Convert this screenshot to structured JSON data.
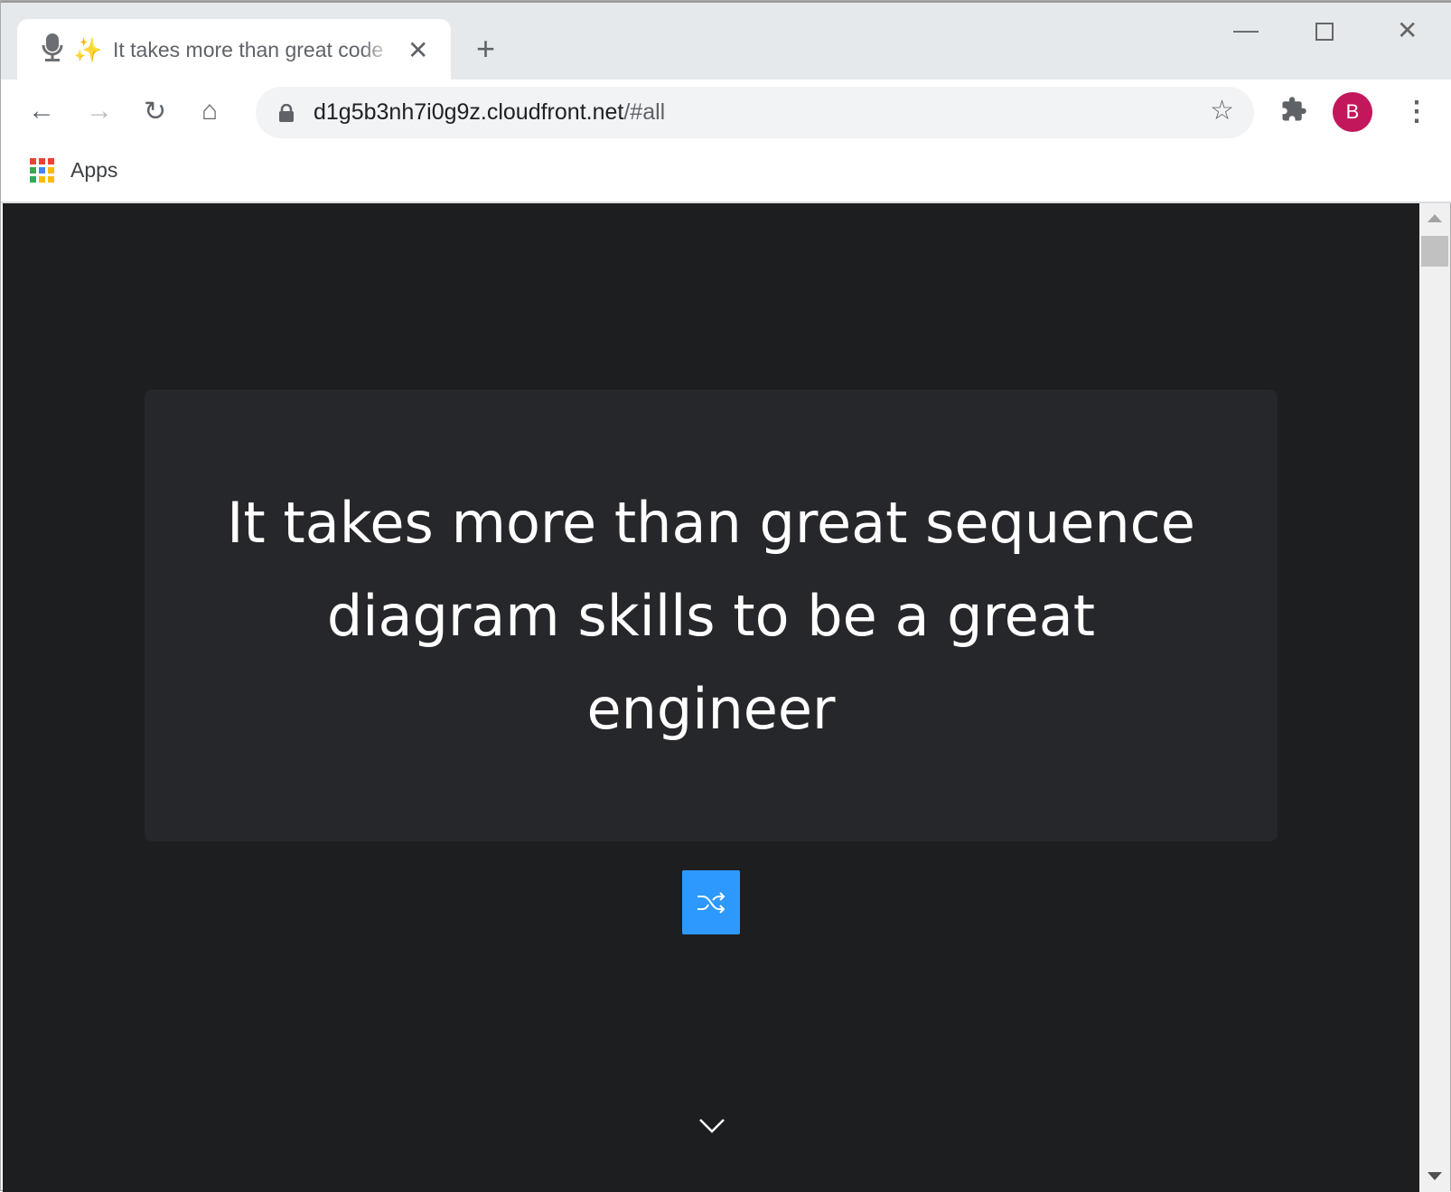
{
  "browser": {
    "tab": {
      "favicon": "microphone-icon",
      "emoji": "✨",
      "title": "It takes more than great code"
    },
    "url": {
      "host": "d1g5b3nh7i0g9z.cloudfront.net",
      "path": "/#all"
    },
    "profile_initial": "B",
    "bookmarks": [
      {
        "label": "Apps"
      }
    ]
  },
  "page": {
    "quote": "It takes more than great sequence diagram skills to be a great engineer",
    "accent": "#2d99ff",
    "background": "#1d1e20",
    "card_background": "#26272b"
  }
}
